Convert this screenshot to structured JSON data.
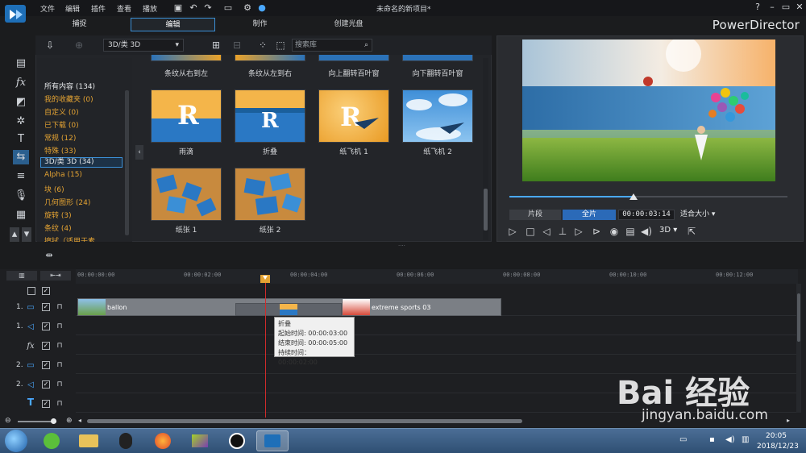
{
  "app": {
    "window_title": "未命名的新项目*",
    "brand": "PowerDirector",
    "menu": [
      "文件",
      "编辑",
      "插件",
      "查看",
      "播放"
    ],
    "modes": [
      "捕捉",
      "编辑",
      "制作",
      "创建光盘"
    ],
    "active_mode": "编辑",
    "accent": "#3b8fd6"
  },
  "library": {
    "category_select": "3D/类 3D",
    "search_placeholder": "搜索库",
    "categories": [
      {
        "label": "所有内容 (134)",
        "color": "white"
      },
      {
        "label": "我的收藏夹 (0)",
        "color": "orange"
      },
      {
        "label": "自定义 (0)",
        "color": "orange"
      },
      {
        "label": "已下载 (0)",
        "color": "orange"
      },
      {
        "label": "常规 (12)",
        "color": "orange"
      },
      {
        "label": "特殊 (33)",
        "color": "orange"
      },
      {
        "label": "3D/类 3D (34)",
        "color": "white",
        "selected": true
      },
      {
        "label": "Alpha (15)",
        "color": "orange"
      },
      {
        "label": "块 (6)",
        "color": "orange"
      },
      {
        "label": "几何图形 (24)",
        "color": "orange"
      },
      {
        "label": "旋转 (3)",
        "color": "orange"
      },
      {
        "label": "条纹 (4)",
        "color": "orange"
      },
      {
        "label": "擦拭（适用于素",
        "color": "orange"
      }
    ],
    "thumbs_top_row": [
      "条纹从右到左",
      "条纹从左到右",
      "向上翻转百叶窗",
      "向下翻转百叶窗"
    ],
    "thumbs": [
      "雨滴",
      "折叠",
      "纸飞机 1",
      "纸飞机 2",
      "纸张 1",
      "纸张 2"
    ]
  },
  "preview": {
    "clip_button": "片段",
    "full_button": "全片",
    "timecode": "00:00:03:14",
    "fit": "适合大小",
    "mode_3d": "3D",
    "progress": 0.45
  },
  "timeline": {
    "ruler": [
      "00:00:00:00",
      "00:00:02:00",
      "00:00:04:00",
      "00:00:06:00",
      "00:00:08:00",
      "00:00:10:00",
      "00:00:12:00"
    ],
    "tracks": [
      "1.",
      "1.",
      "",
      "2.",
      "2.",
      "",
      ""
    ],
    "clip1": "ballon",
    "clip2": "extreme sports 03",
    "tooltip": {
      "title": "折叠",
      "start": "起始时间: 00:00:03:00",
      "end": "结束时间: 00:00:05:00",
      "duration": "持续时间： 00:00:02:00"
    }
  },
  "taskbar": {
    "time": "20:05",
    "date": "2018/12/23"
  },
  "watermark": {
    "main": "Bai 经验",
    "sub": "jingyan.baidu.com"
  }
}
